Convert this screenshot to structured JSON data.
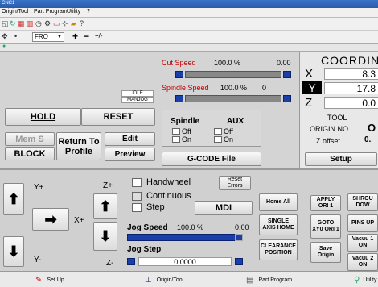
{
  "title_bar": "CNC1",
  "menu": [
    "Origin/Tool",
    "Part Program",
    "Utility",
    "?"
  ],
  "toolbar": {
    "feed_mode": "FRO",
    "plus": "+",
    "minus": "−",
    "plusminus": "+/-"
  },
  "status": {
    "idle": "IDLE",
    "mode": "MANJOG"
  },
  "buttons": {
    "hold": "HOLD",
    "reset": "RESET",
    "mem_s": "Mem S",
    "return_to_profile": "Return To Profile",
    "edit": "Edit",
    "block": "BLOCK",
    "preview": "Preview",
    "gcode_file": "G-CODE File",
    "setup": "Setup",
    "mdi": "MDI",
    "reset_errors": "Reset Errors",
    "home_all": "Home All",
    "single_axis_home": "SINGLE AXIS HOME",
    "clearance_position": "CLEARANCE POSITION",
    "apply_ori": "APPLY ORI 1",
    "goto_xy0": "GOTO XY0 ORI 1",
    "save_origin": "Save Origin",
    "shroud_down": "SHROU DOW",
    "pins_up": "PINS UP",
    "vacuum1": "Vacuu 1 ON",
    "vacuum2": "Vacuu 2 ON"
  },
  "speeds": {
    "cut_label": "Cut Speed",
    "cut_pct": "100.0 %",
    "cut_val": "0.00",
    "spindle_label": "Spindle Speed",
    "spindle_pct": "100.0 %",
    "spindle_val": "0"
  },
  "spindle_panel": {
    "title": "Spindle",
    "aux_title": "AUX",
    "off": "Off",
    "on": "On",
    "aux_off": "Off",
    "aux_on": "On"
  },
  "coords": {
    "title": "COORDIN",
    "x_label": "X",
    "x_val": "8.3",
    "y_label": "Y",
    "y_val": "17.8",
    "z_label": "Z",
    "z_val": "0.0",
    "tool_label": "TOOL",
    "origin_label": "ORIGIN NO",
    "origin_val": "O",
    "zoffset_label": "Z offset",
    "zoffset_val": "0."
  },
  "jog": {
    "y_plus": "Y+",
    "y_minus": "Y-",
    "x_plus": "X+",
    "z_plus": "Z+",
    "z_minus": "Z-",
    "handwheel": "Handwheel",
    "continuous": "Continuous",
    "step": "Step",
    "jog_speed_label": "Jog Speed",
    "jog_speed_pct": "100.0 %",
    "jog_speed_val": "0.00",
    "jog_step_label": "Jog Step",
    "jog_step_val": "0.0000"
  },
  "tabs": [
    "Set Up",
    "Origin/Tool",
    "Part Program",
    "Utility"
  ]
}
